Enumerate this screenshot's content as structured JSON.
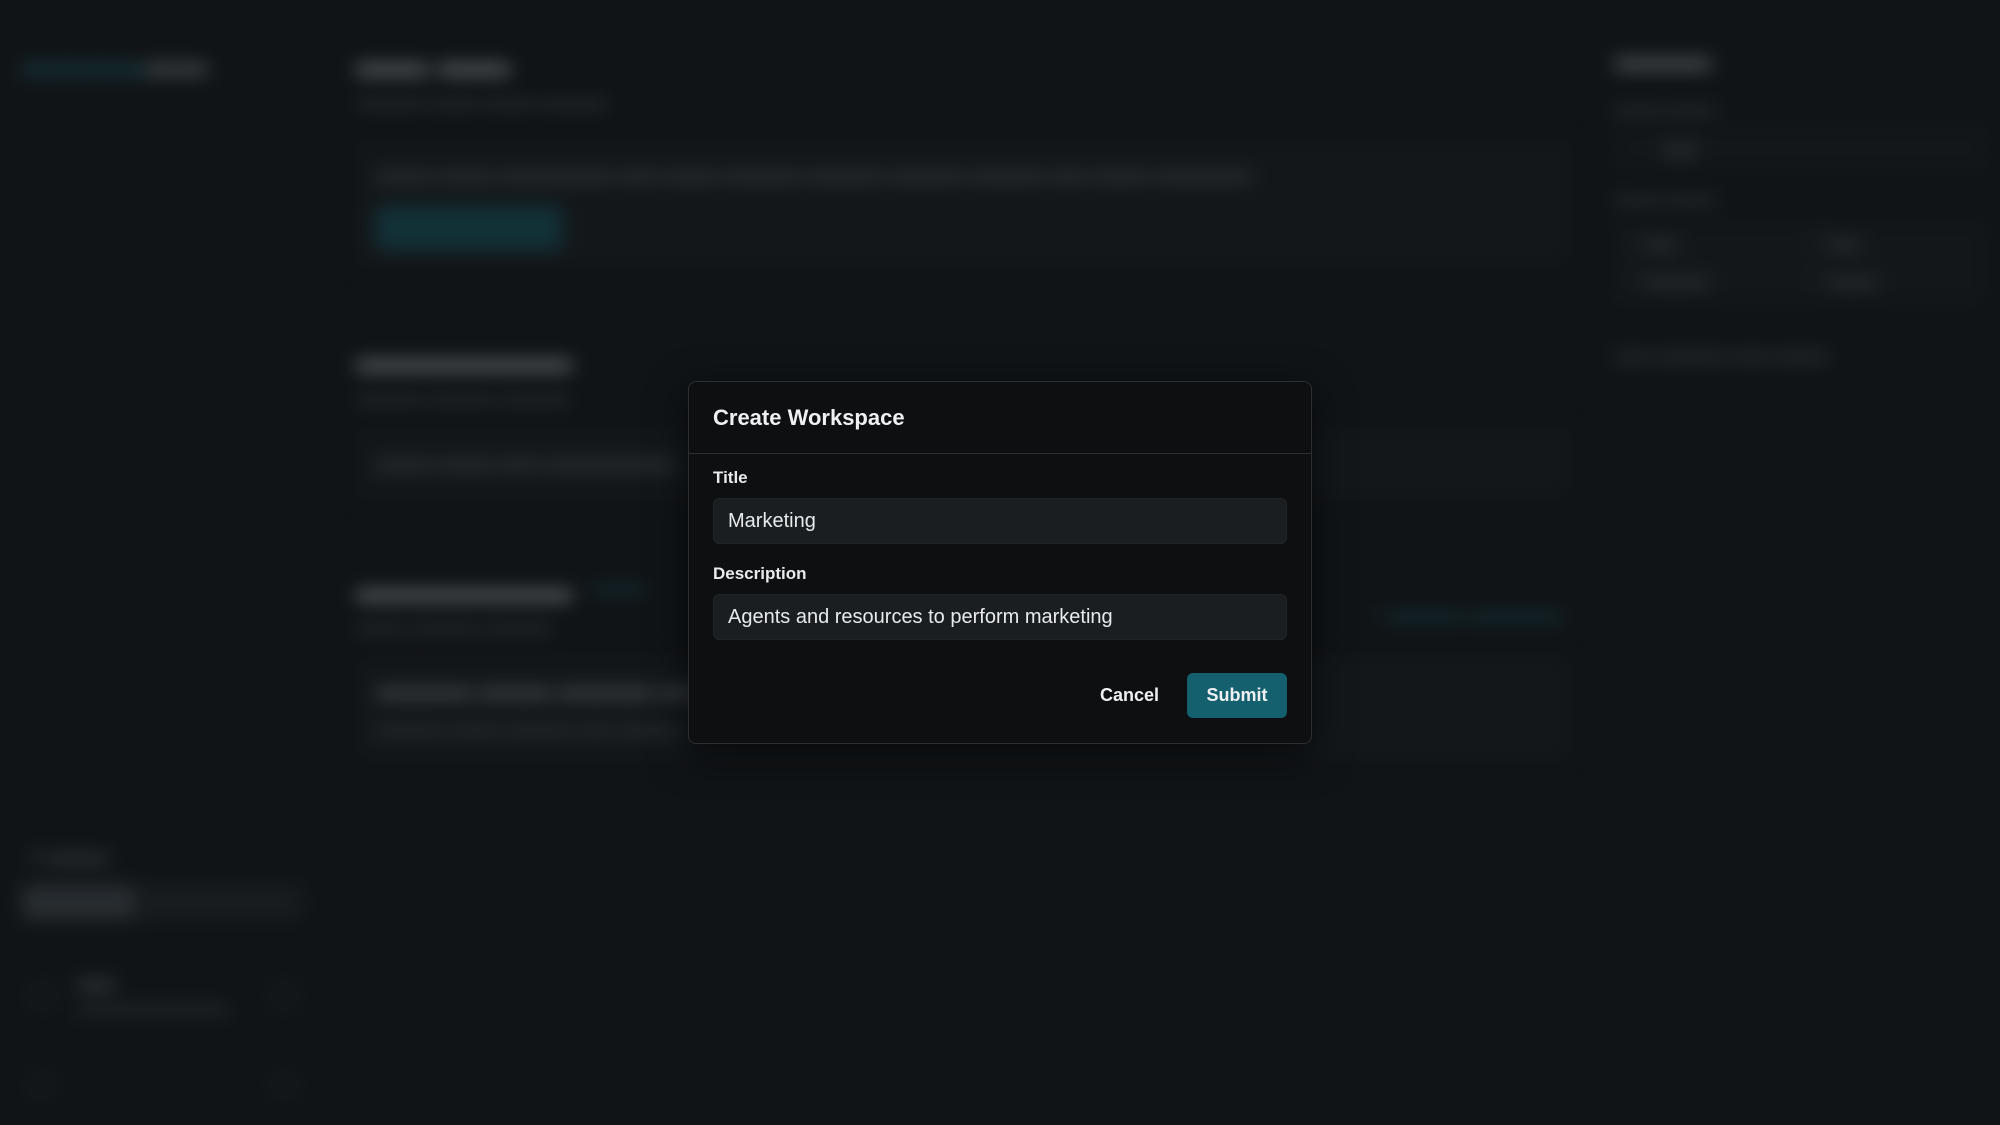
{
  "modal": {
    "title": "Create Workspace",
    "title_label": "Title",
    "title_value": "Marketing",
    "description_label": "Description",
    "description_value": "Agents and resources to perform marketing",
    "cancel_label": "Cancel",
    "submit_label": "Submit"
  },
  "colors": {
    "accent": "#14606e",
    "modal_bg": "#0d0f11",
    "page_bg": "#15191c"
  }
}
